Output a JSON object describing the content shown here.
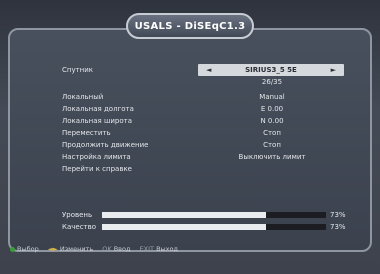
{
  "window": {
    "title": "USALS - DiSEqC1.3"
  },
  "menu": {
    "satellite_label": "Спутник",
    "satellite_value": "SIRIUS3_5 5E",
    "transponder_value": "26/35",
    "items": [
      {
        "label": "Локальный",
        "value": "Manual"
      },
      {
        "label": "Локальная долгота",
        "value": "E 0.00"
      },
      {
        "label": "Локальная широта",
        "value": "N 0.00"
      },
      {
        "label": "Переместить",
        "value": "Стоп"
      },
      {
        "label": "Продолжить движение",
        "value": "Стоп"
      },
      {
        "label": "Настройка лимита",
        "value": "Выключить лимит"
      },
      {
        "label": "Перейти к справке",
        "value": ""
      }
    ]
  },
  "signal": {
    "level_label": "Уровень",
    "level_percent": "73%",
    "level_value": 73,
    "quality_label": "Качество",
    "quality_percent": "73%",
    "quality_value": 73
  },
  "footer": {
    "select": "Выбор",
    "change": "Изменить",
    "ok": "Ввод",
    "exit": "Выход",
    "ok_key": "OK",
    "exit_key": "EXIT",
    "change_key": "◄►"
  },
  "colors": {
    "select_dot": "#3c9c3c",
    "change_key": "#d6b44a",
    "ok_key": "#9aa0a8",
    "exit_key": "#9aa0a8"
  }
}
